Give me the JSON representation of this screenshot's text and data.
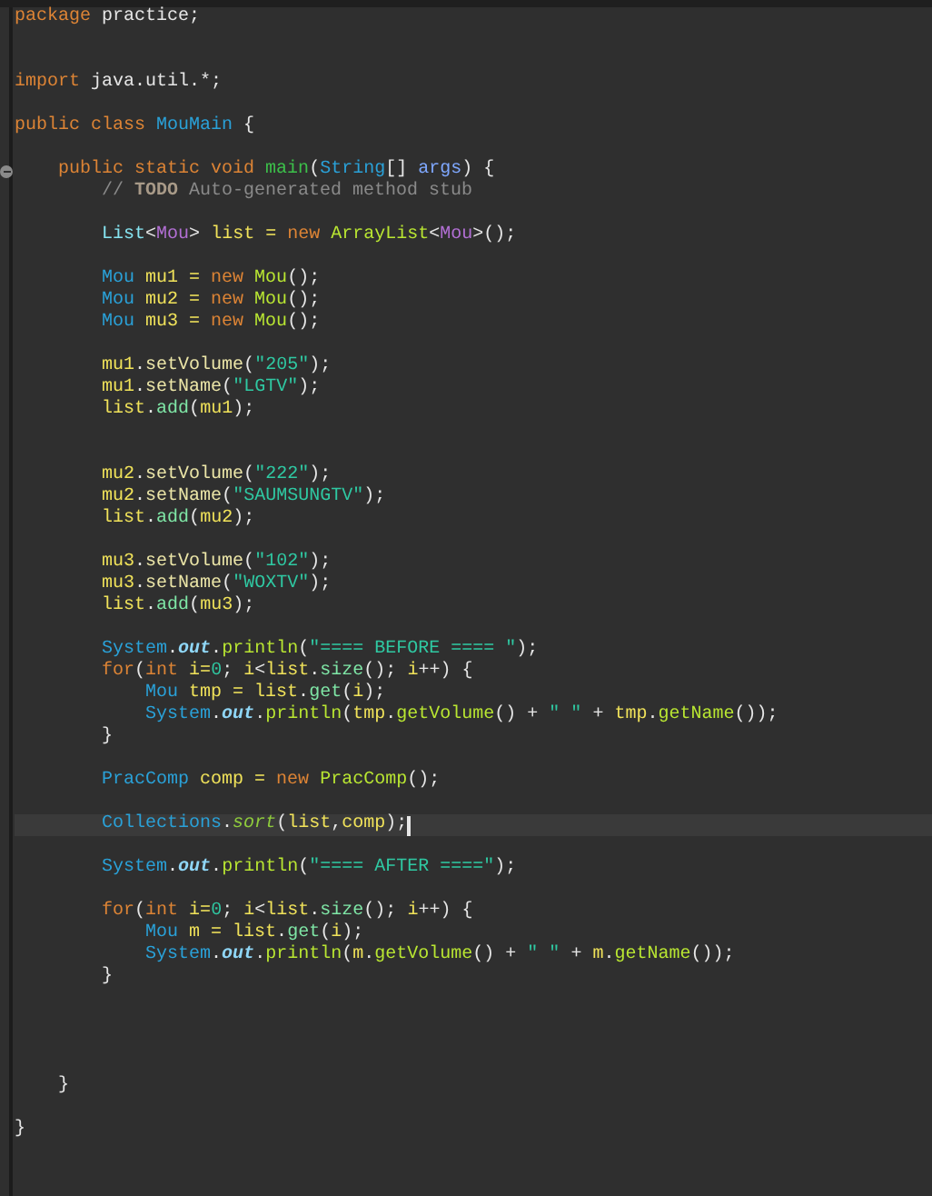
{
  "editor": {
    "lines": [
      {
        "current": false,
        "tokens": [
          {
            "text": "package ",
            "color": "#dd8435"
          },
          {
            "text": "practice;",
            "color": "#e6e6e6"
          }
        ]
      },
      {
        "current": false
      },
      {
        "current": false
      },
      {
        "current": false,
        "tokens": [
          {
            "text": "import ",
            "color": "#dd8435"
          },
          {
            "text": "java.util.*;",
            "color": "#e6e6e6"
          }
        ]
      },
      {
        "current": false
      },
      {
        "current": false,
        "tokens": [
          {
            "text": "public ",
            "color": "#dd8435"
          },
          {
            "text": "class ",
            "color": "#dd8435"
          },
          {
            "text": "MouMain",
            "color": "#2aa1d8"
          },
          {
            "text": " {",
            "color": "#e6e6e6"
          }
        ]
      },
      {
        "current": false
      },
      {
        "current": false,
        "fold": true,
        "tokens": [
          {
            "text": "    public ",
            "color": "#dd8435"
          },
          {
            "text": "static ",
            "color": "#dd8435"
          },
          {
            "text": "void ",
            "color": "#dd8435"
          },
          {
            "text": "main",
            "color": "#3cc04a"
          },
          {
            "text": "(",
            "color": "#e6e6e6"
          },
          {
            "text": "String",
            "color": "#2aa1d8"
          },
          {
            "text": "[] ",
            "color": "#e6e6e6"
          },
          {
            "text": "args",
            "color": "#7fa8ff"
          },
          {
            "text": ") {",
            "color": "#e6e6e6"
          }
        ]
      },
      {
        "current": false,
        "tokens": [
          {
            "text": "        // ",
            "color": "#8a8a8a"
          },
          {
            "text": "TODO",
            "color": "#a89a88",
            "kind": "strong"
          },
          {
            "text": " Auto-generated method stub",
            "color": "#8a8a8a"
          }
        ]
      },
      {
        "current": false
      },
      {
        "current": false,
        "tokens": [
          {
            "text": "        List",
            "color": "#86e4f0"
          },
          {
            "text": "<",
            "color": "#e6e6e6"
          },
          {
            "text": "Mou",
            "color": "#b26fd4"
          },
          {
            "text": "> ",
            "color": "#e6e6e6"
          },
          {
            "text": "list = ",
            "color": "#f0e25a"
          },
          {
            "text": "new ",
            "color": "#dd8435"
          },
          {
            "text": "ArrayList",
            "color": "#b9e632"
          },
          {
            "text": "<",
            "color": "#e6e6e6"
          },
          {
            "text": "Mou",
            "color": "#b26fd4"
          },
          {
            "text": ">();",
            "color": "#e6e6e6"
          }
        ]
      },
      {
        "current": false
      },
      {
        "current": false,
        "tokens": [
          {
            "text": "        Mou ",
            "color": "#2aa1d8"
          },
          {
            "text": "mu1 = ",
            "color": "#f0e25a"
          },
          {
            "text": "new ",
            "color": "#dd8435"
          },
          {
            "text": "Mou",
            "color": "#b9e632"
          },
          {
            "text": "();",
            "color": "#e6e6e6"
          }
        ]
      },
      {
        "current": false,
        "tokens": [
          {
            "text": "        Mou ",
            "color": "#2aa1d8"
          },
          {
            "text": "mu2 = ",
            "color": "#f0e25a"
          },
          {
            "text": "new ",
            "color": "#dd8435"
          },
          {
            "text": "Mou",
            "color": "#b9e632"
          },
          {
            "text": "();",
            "color": "#e6e6e6"
          }
        ]
      },
      {
        "current": false,
        "tokens": [
          {
            "text": "        Mou ",
            "color": "#2aa1d8"
          },
          {
            "text": "mu3 = ",
            "color": "#f0e25a"
          },
          {
            "text": "new ",
            "color": "#dd8435"
          },
          {
            "text": "Mou",
            "color": "#b9e632"
          },
          {
            "text": "();",
            "color": "#e6e6e6"
          }
        ]
      },
      {
        "current": false
      },
      {
        "current": false,
        "tokens": [
          {
            "text": "        mu1",
            "color": "#f0e25a"
          },
          {
            "text": ".",
            "color": "#e6e6e6"
          },
          {
            "text": "setVolume",
            "color": "#ece6a8"
          },
          {
            "text": "(",
            "color": "#e6e6e6"
          },
          {
            "text": "\"205\"",
            "color": "#2fc8a2"
          },
          {
            "text": ");",
            "color": "#e6e6e6"
          }
        ]
      },
      {
        "current": false,
        "tokens": [
          {
            "text": "        mu1",
            "color": "#f0e25a"
          },
          {
            "text": ".",
            "color": "#e6e6e6"
          },
          {
            "text": "setName",
            "color": "#ece6a8"
          },
          {
            "text": "(",
            "color": "#e6e6e6"
          },
          {
            "text": "\"LGTV\"",
            "color": "#2fc8a2"
          },
          {
            "text": ");",
            "color": "#e6e6e6"
          }
        ]
      },
      {
        "current": false,
        "tokens": [
          {
            "text": "        list",
            "color": "#f0e25a"
          },
          {
            "text": ".",
            "color": "#e6e6e6"
          },
          {
            "text": "add",
            "color": "#7fe6a6"
          },
          {
            "text": "(",
            "color": "#e6e6e6"
          },
          {
            "text": "mu1",
            "color": "#f0e25a"
          },
          {
            "text": ");",
            "color": "#e6e6e6"
          }
        ]
      },
      {
        "current": false
      },
      {
        "current": false
      },
      {
        "current": false,
        "tokens": [
          {
            "text": "        mu2",
            "color": "#f0e25a"
          },
          {
            "text": ".",
            "color": "#e6e6e6"
          },
          {
            "text": "setVolume",
            "color": "#ece6a8"
          },
          {
            "text": "(",
            "color": "#e6e6e6"
          },
          {
            "text": "\"222\"",
            "color": "#2fc8a2"
          },
          {
            "text": ");",
            "color": "#e6e6e6"
          }
        ]
      },
      {
        "current": false,
        "tokens": [
          {
            "text": "        mu2",
            "color": "#f0e25a"
          },
          {
            "text": ".",
            "color": "#e6e6e6"
          },
          {
            "text": "setName",
            "color": "#ece6a8"
          },
          {
            "text": "(",
            "color": "#e6e6e6"
          },
          {
            "text": "\"SAUMSUNGTV\"",
            "color": "#2fc8a2"
          },
          {
            "text": ");",
            "color": "#e6e6e6"
          }
        ]
      },
      {
        "current": false,
        "tokens": [
          {
            "text": "        list",
            "color": "#f0e25a"
          },
          {
            "text": ".",
            "color": "#e6e6e6"
          },
          {
            "text": "add",
            "color": "#7fe6a6"
          },
          {
            "text": "(",
            "color": "#e6e6e6"
          },
          {
            "text": "mu2",
            "color": "#f0e25a"
          },
          {
            "text": ");",
            "color": "#e6e6e6"
          }
        ]
      },
      {
        "current": false
      },
      {
        "current": false,
        "tokens": [
          {
            "text": "        mu3",
            "color": "#f0e25a"
          },
          {
            "text": ".",
            "color": "#e6e6e6"
          },
          {
            "text": "setVolume",
            "color": "#ece6a8"
          },
          {
            "text": "(",
            "color": "#e6e6e6"
          },
          {
            "text": "\"102\"",
            "color": "#2fc8a2"
          },
          {
            "text": ");",
            "color": "#e6e6e6"
          }
        ]
      },
      {
        "current": false,
        "tokens": [
          {
            "text": "        mu3",
            "color": "#f0e25a"
          },
          {
            "text": ".",
            "color": "#e6e6e6"
          },
          {
            "text": "setName",
            "color": "#ece6a8"
          },
          {
            "text": "(",
            "color": "#e6e6e6"
          },
          {
            "text": "\"WOXTV\"",
            "color": "#2fc8a2"
          },
          {
            "text": ");",
            "color": "#e6e6e6"
          }
        ]
      },
      {
        "current": false,
        "tokens": [
          {
            "text": "        list",
            "color": "#f0e25a"
          },
          {
            "text": ".",
            "color": "#e6e6e6"
          },
          {
            "text": "add",
            "color": "#7fe6a6"
          },
          {
            "text": "(",
            "color": "#e6e6e6"
          },
          {
            "text": "mu3",
            "color": "#f0e25a"
          },
          {
            "text": ");",
            "color": "#e6e6e6"
          }
        ]
      },
      {
        "current": false
      },
      {
        "current": false,
        "tokens": [
          {
            "text": "        System",
            "color": "#2aa1d8"
          },
          {
            "text": ".",
            "color": "#e6e6e6"
          },
          {
            "text": "out",
            "color": "#8fd6f6",
            "kind": "static"
          },
          {
            "text": ".",
            "color": "#e6e6e6"
          },
          {
            "text": "println",
            "color": "#b9e632"
          },
          {
            "text": "(",
            "color": "#e6e6e6"
          },
          {
            "text": "\"==== BEFORE ==== \"",
            "color": "#2fc8a2"
          },
          {
            "text": ");",
            "color": "#e6e6e6"
          }
        ]
      },
      {
        "current": false,
        "tokens": [
          {
            "text": "        for",
            "color": "#dd8435"
          },
          {
            "text": "(",
            "color": "#e6e6e6"
          },
          {
            "text": "int ",
            "color": "#dd8435"
          },
          {
            "text": "i=",
            "color": "#f0e25a"
          },
          {
            "text": "0",
            "color": "#2fc8a2"
          },
          {
            "text": "; ",
            "color": "#e6e6e6"
          },
          {
            "text": "i",
            "color": "#f0e25a"
          },
          {
            "text": "<",
            "color": "#e6e6e6"
          },
          {
            "text": "list",
            "color": "#f0e25a"
          },
          {
            "text": ".",
            "color": "#e6e6e6"
          },
          {
            "text": "size",
            "color": "#7fe6a6"
          },
          {
            "text": "(); ",
            "color": "#e6e6e6"
          },
          {
            "text": "i",
            "color": "#f0e25a"
          },
          {
            "text": "++) {",
            "color": "#e6e6e6"
          }
        ]
      },
      {
        "current": false,
        "tokens": [
          {
            "text": "            Mou ",
            "color": "#2aa1d8"
          },
          {
            "text": "tmp = ",
            "color": "#f0e25a"
          },
          {
            "text": "list",
            "color": "#f0e25a"
          },
          {
            "text": ".",
            "color": "#e6e6e6"
          },
          {
            "text": "get",
            "color": "#7fe6a6"
          },
          {
            "text": "(",
            "color": "#e6e6e6"
          },
          {
            "text": "i",
            "color": "#f0e25a"
          },
          {
            "text": ");",
            "color": "#e6e6e6"
          }
        ]
      },
      {
        "current": false,
        "tokens": [
          {
            "text": "            System",
            "color": "#2aa1d8"
          },
          {
            "text": ".",
            "color": "#e6e6e6"
          },
          {
            "text": "out",
            "color": "#8fd6f6",
            "kind": "static"
          },
          {
            "text": ".",
            "color": "#e6e6e6"
          },
          {
            "text": "println",
            "color": "#b9e632"
          },
          {
            "text": "(",
            "color": "#e6e6e6"
          },
          {
            "text": "tmp",
            "color": "#f0e25a"
          },
          {
            "text": ".",
            "color": "#e6e6e6"
          },
          {
            "text": "getVolume",
            "color": "#b9e632"
          },
          {
            "text": "() + ",
            "color": "#e6e6e6"
          },
          {
            "text": "\" \"",
            "color": "#2fc8a2"
          },
          {
            "text": " + ",
            "color": "#e6e6e6"
          },
          {
            "text": "tmp",
            "color": "#f0e25a"
          },
          {
            "text": ".",
            "color": "#e6e6e6"
          },
          {
            "text": "getName",
            "color": "#b9e632"
          },
          {
            "text": "());",
            "color": "#e6e6e6"
          }
        ]
      },
      {
        "current": false,
        "tokens": [
          {
            "text": "        }",
            "color": "#e6e6e6"
          }
        ]
      },
      {
        "current": false
      },
      {
        "current": false,
        "tokens": [
          {
            "text": "        PracComp ",
            "color": "#2aa1d8"
          },
          {
            "text": "comp = ",
            "color": "#f0e25a"
          },
          {
            "text": "new ",
            "color": "#dd8435"
          },
          {
            "text": "PracComp",
            "color": "#b9e632"
          },
          {
            "text": "();",
            "color": "#e6e6e6"
          }
        ]
      },
      {
        "current": false
      },
      {
        "current": true,
        "tokens": [
          {
            "text": "        Collections",
            "color": "#2aa1d8"
          },
          {
            "text": ".",
            "color": "#e6e6e6"
          },
          {
            "text": "sort",
            "color": "#8fcc3c",
            "kind": "emphasis"
          },
          {
            "text": "(",
            "color": "#e6e6e6"
          },
          {
            "text": "list",
            "color": "#f0e25a"
          },
          {
            "text": ",",
            "color": "#e6e6e6"
          },
          {
            "text": "comp",
            "color": "#f0e25a"
          },
          {
            "text": ");",
            "color": "#e6e6e6"
          }
        ]
      },
      {
        "current": false
      },
      {
        "current": false,
        "tokens": [
          {
            "text": "        System",
            "color": "#2aa1d8"
          },
          {
            "text": ".",
            "color": "#e6e6e6"
          },
          {
            "text": "out",
            "color": "#8fd6f6",
            "kind": "static"
          },
          {
            "text": ".",
            "color": "#e6e6e6"
          },
          {
            "text": "println",
            "color": "#b9e632"
          },
          {
            "text": "(",
            "color": "#e6e6e6"
          },
          {
            "text": "\"==== AFTER ====\"",
            "color": "#2fc8a2"
          },
          {
            "text": ");",
            "color": "#e6e6e6"
          }
        ]
      },
      {
        "current": false
      },
      {
        "current": false,
        "tokens": [
          {
            "text": "        for",
            "color": "#dd8435"
          },
          {
            "text": "(",
            "color": "#e6e6e6"
          },
          {
            "text": "int ",
            "color": "#dd8435"
          },
          {
            "text": "i=",
            "color": "#f0e25a"
          },
          {
            "text": "0",
            "color": "#2fc8a2"
          },
          {
            "text": "; ",
            "color": "#e6e6e6"
          },
          {
            "text": "i",
            "color": "#f0e25a"
          },
          {
            "text": "<",
            "color": "#e6e6e6"
          },
          {
            "text": "list",
            "color": "#f0e25a"
          },
          {
            "text": ".",
            "color": "#e6e6e6"
          },
          {
            "text": "size",
            "color": "#7fe6a6"
          },
          {
            "text": "(); ",
            "color": "#e6e6e6"
          },
          {
            "text": "i",
            "color": "#f0e25a"
          },
          {
            "text": "++) {",
            "color": "#e6e6e6"
          }
        ]
      },
      {
        "current": false,
        "tokens": [
          {
            "text": "            Mou ",
            "color": "#2aa1d8"
          },
          {
            "text": "m = ",
            "color": "#f0e25a"
          },
          {
            "text": "list",
            "color": "#f0e25a"
          },
          {
            "text": ".",
            "color": "#e6e6e6"
          },
          {
            "text": "get",
            "color": "#7fe6a6"
          },
          {
            "text": "(",
            "color": "#e6e6e6"
          },
          {
            "text": "i",
            "color": "#f0e25a"
          },
          {
            "text": ");",
            "color": "#e6e6e6"
          }
        ]
      },
      {
        "current": false,
        "tokens": [
          {
            "text": "            System",
            "color": "#2aa1d8"
          },
          {
            "text": ".",
            "color": "#e6e6e6"
          },
          {
            "text": "out",
            "color": "#8fd6f6",
            "kind": "static"
          },
          {
            "text": ".",
            "color": "#e6e6e6"
          },
          {
            "text": "println",
            "color": "#b9e632"
          },
          {
            "text": "(",
            "color": "#e6e6e6"
          },
          {
            "text": "m",
            "color": "#f0e25a"
          },
          {
            "text": ".",
            "color": "#e6e6e6"
          },
          {
            "text": "getVolume",
            "color": "#b9e632"
          },
          {
            "text": "() + ",
            "color": "#e6e6e6"
          },
          {
            "text": "\" \"",
            "color": "#2fc8a2"
          },
          {
            "text": " + ",
            "color": "#e6e6e6"
          },
          {
            "text": "m",
            "color": "#f0e25a"
          },
          {
            "text": ".",
            "color": "#e6e6e6"
          },
          {
            "text": "getName",
            "color": "#b9e632"
          },
          {
            "text": "());",
            "color": "#e6e6e6"
          }
        ]
      },
      {
        "current": false,
        "tokens": [
          {
            "text": "        }",
            "color": "#e6e6e6"
          }
        ]
      },
      {
        "current": false
      },
      {
        "current": false
      },
      {
        "current": false
      },
      {
        "current": false
      },
      {
        "current": false,
        "tokens": [
          {
            "text": "    }",
            "color": "#e6e6e6"
          }
        ]
      },
      {
        "current": false
      },
      {
        "current": false,
        "tokens": [
          {
            "text": "}",
            "color": "#e6e6e6"
          }
        ]
      }
    ]
  }
}
